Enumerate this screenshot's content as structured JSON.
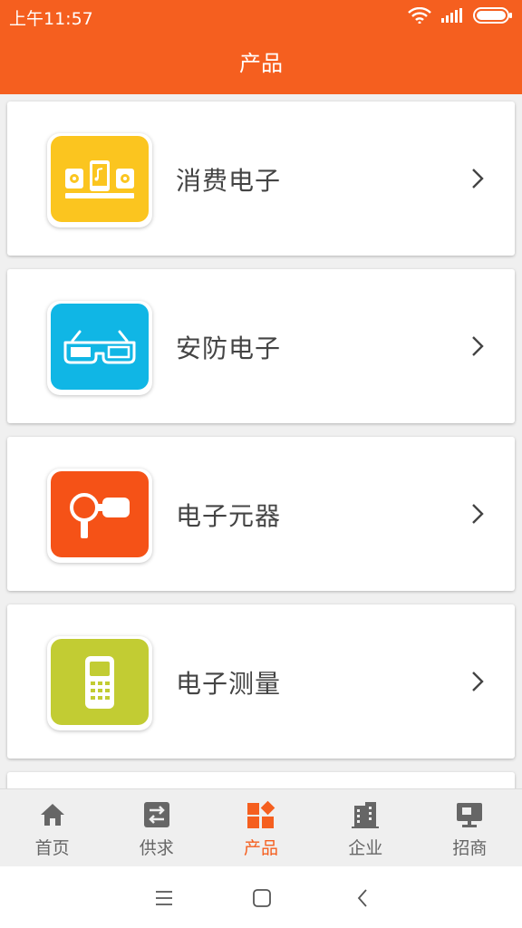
{
  "status_bar": {
    "time": "上午11:57"
  },
  "header": {
    "title": "产品"
  },
  "categories": [
    {
      "label": "消费电子",
      "color": "#fbc51f",
      "icon": "audio-devices-icon"
    },
    {
      "label": "安防电子",
      "color": "#10b6e5",
      "icon": "glasses-icon"
    },
    {
      "label": "电子元器",
      "color": "#f55217",
      "icon": "component-icon"
    },
    {
      "label": "电子测量",
      "color": "#c2cc33",
      "icon": "meter-icon"
    }
  ],
  "tabs": [
    {
      "label": "首页",
      "icon": "home-icon"
    },
    {
      "label": "供求",
      "icon": "exchange-icon"
    },
    {
      "label": "产品",
      "icon": "products-icon",
      "active": true
    },
    {
      "label": "企业",
      "icon": "building-icon"
    },
    {
      "label": "招商",
      "icon": "monitor-icon"
    }
  ],
  "colors": {
    "accent": "#f55f1f",
    "tab_inactive": "#666666"
  }
}
